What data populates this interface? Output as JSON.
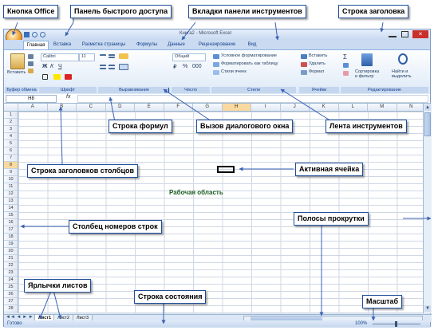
{
  "window": {
    "title": "Книга2 - Microsoft Excel",
    "tabs": [
      "Главная",
      "Вставка",
      "Разметка страницы",
      "Формулы",
      "Данные",
      "Рецензирование",
      "Вид"
    ]
  },
  "ribbon": {
    "paste": "Вставить",
    "font_name": "Calibri",
    "font_size": "11",
    "number_format": "Общий",
    "cond_format": "Условное форматирование",
    "format_table": "Форматировать как таблицу",
    "cell_styles": "Стили ячеек",
    "insert": "Вставить",
    "delete": "Удалить",
    "format": "Формат",
    "sort_filter": "Сортировка и фильтр",
    "find_select": "Найти и выделить",
    "groups": {
      "clipboard": "Буфер обмена",
      "font": "Шрифт",
      "alignment": "Выравнивание",
      "number": "Число",
      "styles": "Стили",
      "cells": "Ячейки",
      "editing": "Редактирование"
    }
  },
  "formula_bar": {
    "name_box": "H8",
    "fx": "fx"
  },
  "columns": [
    "A",
    "B",
    "C",
    "D",
    "E",
    "F",
    "G",
    "H",
    "I",
    "J",
    "K",
    "L",
    "M",
    "N"
  ],
  "rows": [
    "1",
    "2",
    "3",
    "4",
    "5",
    "6",
    "7",
    "8",
    "9",
    "10",
    "11",
    "12",
    "13",
    "14",
    "15",
    "16",
    "17",
    "18",
    "19",
    "20",
    "21",
    "22",
    "23",
    "24",
    "25",
    "26",
    "27",
    "28"
  ],
  "sheet_tabs": [
    "Лист1",
    "Лист2",
    "Лист3"
  ],
  "status": {
    "ready": "Готово",
    "zoom": "100%"
  },
  "callouts": {
    "office_button": "Кнопка Office",
    "quick_access": "Панель быстрого доступа",
    "ribbon_tabs": "Вкладки панели инструментов",
    "title_bar": "Строка заголовка",
    "formula_bar": "Строка формул",
    "dialog_launcher": "Вызов диалогового окна",
    "ribbon": "Лента инструментов",
    "column_headers": "Строка заголовков столбцов",
    "active_cell": "Активная ячейка",
    "work_area": "Рабочая область",
    "row_numbers": "Столбец номеров строк",
    "scrollbars": "Полосы прокрутки",
    "sheet_tabs": "Ярлычки листов",
    "status_bar": "Строка состояния",
    "zoom": "Масштаб"
  },
  "colors": {
    "callout_border": "#1f4e99",
    "ribbon_bg": "#dbe7f6",
    "arrow": "#3a62b4",
    "work_area_text": "#1b5e20"
  }
}
